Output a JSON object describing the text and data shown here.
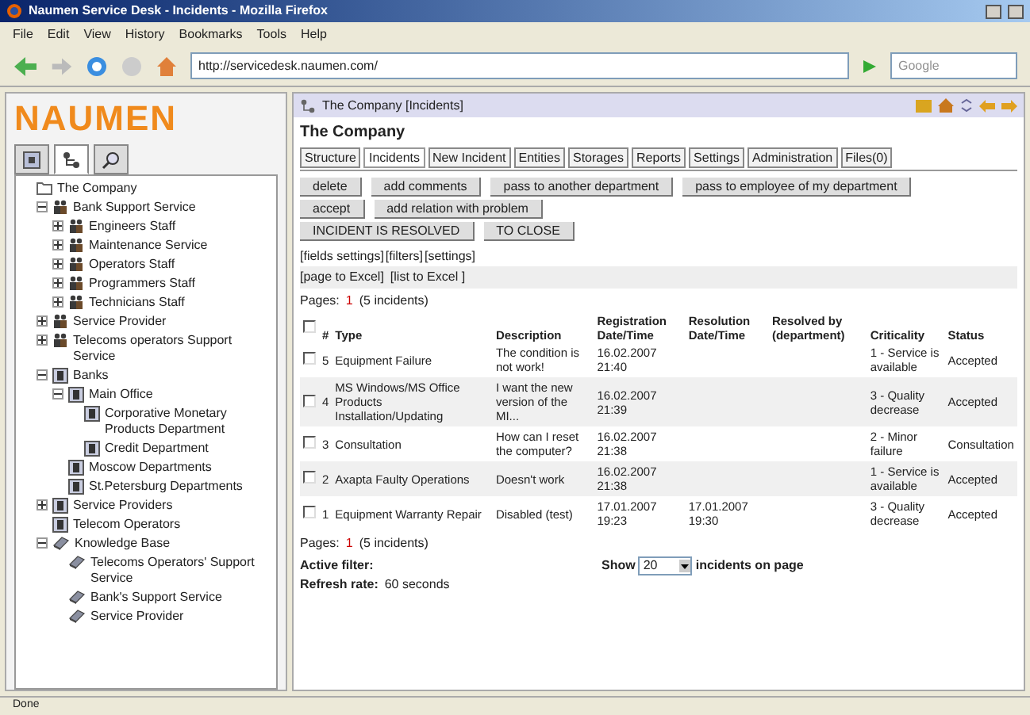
{
  "window": {
    "title": "Naumen Service Desk - Incidents - Mozilla Firefox"
  },
  "menu": [
    "File",
    "Edit",
    "View",
    "History",
    "Bookmarks",
    "Tools",
    "Help"
  ],
  "address": {
    "value": "http://servicedesk.naumen.com/"
  },
  "search": {
    "placeholder": "Google"
  },
  "sidebar": {
    "logo": "NAUMEN",
    "tabs": [
      {
        "kind": "object",
        "selected": false
      },
      {
        "kind": "tree",
        "selected": true
      },
      {
        "kind": "search",
        "selected": false
      }
    ],
    "tree": [
      {
        "label": "The Company",
        "kind": "folder",
        "children": [
          {
            "label": "Bank Support Service",
            "kind": "group",
            "expanded": true,
            "children": [
              {
                "label": "Engineers Staff",
                "kind": "group",
                "expanded": false
              },
              {
                "label": "Maintenance Service",
                "kind": "group",
                "expanded": false
              },
              {
                "label": "Operators Staff",
                "kind": "group",
                "expanded": false
              },
              {
                "label": "Programmers Staff",
                "kind": "group",
                "expanded": false
              },
              {
                "label": "Technicians Staff",
                "kind": "group",
                "expanded": false
              }
            ]
          },
          {
            "label": "Service Provider",
            "kind": "group",
            "expanded": false
          },
          {
            "label": "Telecoms operators Support Service",
            "kind": "group",
            "expanded": false
          },
          {
            "label": "Banks",
            "kind": "bank",
            "expanded": true,
            "children": [
              {
                "label": "Main Office",
                "kind": "bank",
                "expanded": true,
                "children": [
                  {
                    "label": "Corporative Monetary Products Department",
                    "kind": "bank"
                  },
                  {
                    "label": "Credit Department",
                    "kind": "bank"
                  }
                ]
              },
              {
                "label": "Moscow Departments",
                "kind": "bank"
              },
              {
                "label": "St.Petersburg Departments",
                "kind": "bank"
              }
            ]
          },
          {
            "label": "Service Providers",
            "kind": "bank",
            "expanded": false
          },
          {
            "label": "Telecom Operators",
            "kind": "bank"
          },
          {
            "label": "Knowledge Base",
            "kind": "book",
            "expanded": true,
            "children": [
              {
                "label": "Telecoms Operators' Support Service",
                "kind": "book"
              },
              {
                "label": "Bank's Support Service",
                "kind": "book"
              },
              {
                "label": "Service Provider",
                "kind": "book"
              }
            ]
          }
        ]
      }
    ]
  },
  "main": {
    "breadcrumb": "The Company [Incidents]",
    "heading": "The Company",
    "tabs": [
      {
        "label": "Structure",
        "selected": false
      },
      {
        "label": "Incidents",
        "selected": true
      },
      {
        "label": "New Incident",
        "selected": false
      },
      {
        "label": "Entities",
        "selected": false
      },
      {
        "label": "Storages",
        "selected": false
      },
      {
        "label": "Reports",
        "selected": false
      },
      {
        "label": "Settings",
        "selected": false
      },
      {
        "label": "Administration",
        "selected": false
      },
      {
        "label": "Files(0)",
        "selected": false
      }
    ],
    "button_rows": [
      [
        "delete",
        "add comments",
        "pass to another department",
        "pass to employee of my department"
      ],
      [
        "accept",
        "add relation with problem"
      ],
      [
        "INCIDENT IS RESOLVED",
        "TO CLOSE"
      ]
    ],
    "settings_links": [
      "[fields settings]",
      "[filters]",
      "[settings]"
    ],
    "excel_links": [
      "[page to Excel]",
      "[list to Excel ]"
    ],
    "pages_top": {
      "label": "Pages:",
      "page": "1",
      "count": "(5 incidents)"
    },
    "table": {
      "select_all": {
        "checked": false
      },
      "columns": [
        "#",
        "Type",
        "Description",
        "Registration Date/Time",
        "Resolution Date/Time",
        "Resolved by (department)",
        "Criticality",
        "Status"
      ],
      "rows": [
        {
          "checked": false,
          "cells": [
            "5",
            "Equipment Failure",
            "The condition is not work!",
            "16.02.2007 21:40",
            "",
            "",
            "1 - Service is available",
            "Accepted"
          ]
        },
        {
          "checked": false,
          "cells": [
            "4",
            "MS Windows/MS Office Products Installation/Updating",
            "I want the new version of the MI...",
            "16.02.2007 21:39",
            "",
            "",
            "3 - Quality decrease",
            "Accepted"
          ]
        },
        {
          "checked": false,
          "cells": [
            "3",
            "Consultation",
            "How can I reset the computer?",
            "16.02.2007 21:38",
            "",
            "",
            "2 - Minor failure",
            "Consultation"
          ]
        },
        {
          "checked": false,
          "cells": [
            "2",
            "Axapta Faulty Operations",
            "Doesn't work",
            "16.02.2007 21:38",
            "",
            "",
            "1 - Service is available",
            "Accepted"
          ]
        },
        {
          "checked": false,
          "cells": [
            "1",
            "Equipment Warranty Repair",
            "Disabled (test)",
            "17.01.2007 19:23",
            "17.01.2007 19:30",
            "",
            "3 - Quality decrease",
            "Accepted"
          ]
        }
      ]
    },
    "pages_bottom": {
      "label": "Pages:",
      "page": "1",
      "count": "(5 incidents)"
    },
    "active_filter": "Active filter:",
    "refresh": {
      "label": "Refresh rate:",
      "value": "60 seconds"
    },
    "page_size": {
      "before": "Show",
      "value": "20",
      "after": "incidents on page"
    }
  },
  "status_bar": "Done"
}
